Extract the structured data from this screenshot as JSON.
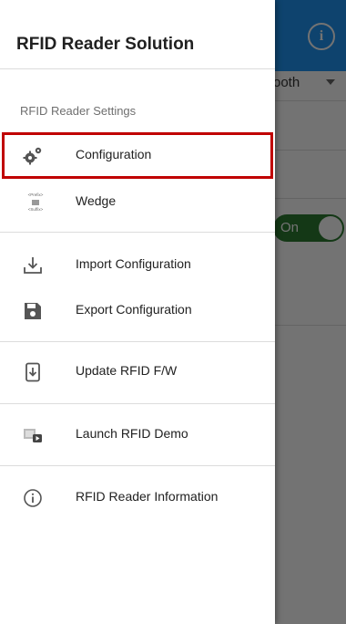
{
  "drawer": {
    "title": "RFID Reader Solution",
    "section_label": "RFID Reader Settings",
    "items": [
      {
        "label": "Configuration",
        "icon": "gears-icon"
      },
      {
        "label": "Wedge",
        "icon": "prefix-suffix-icon",
        "icon_text_top": "<Prefix>",
        "icon_text_bottom": "<Suffix>"
      },
      {
        "label": "Import Configuration",
        "icon": "download-tray-icon"
      },
      {
        "label": "Export Configuration",
        "icon": "save-icon"
      },
      {
        "label": "Update RFID F/W",
        "icon": "firmware-update-icon"
      },
      {
        "label": "Launch RFID Demo",
        "icon": "demo-icon"
      },
      {
        "label": "RFID Reader Information",
        "icon": "info-icon"
      }
    ]
  },
  "background": {
    "dropdown_partial_text": "ooth",
    "toggle_label": "On",
    "info_icon": "info-icon"
  },
  "colors": {
    "topbar": "#2196f3",
    "highlight": "#c00000",
    "toggle": "#2e7d32"
  }
}
